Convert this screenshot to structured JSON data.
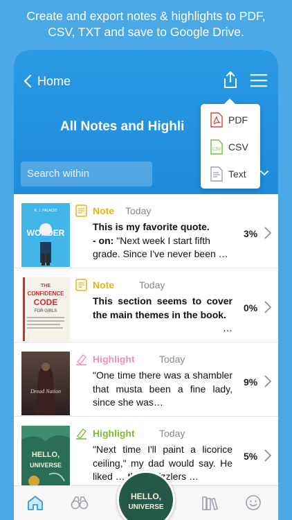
{
  "promo": {
    "line1": "Create and export notes & highlights to PDF,",
    "line2": "CSV, TXT and save to Google Drive."
  },
  "header": {
    "back_label": "Home",
    "title": "All Notes and Highli",
    "search_placeholder": "Search within"
  },
  "export_menu": {
    "items": [
      {
        "label": "PDF",
        "icon": "pdf-file-icon",
        "color": "#d9413a"
      },
      {
        "label": "CSV",
        "icon": "csv-file-icon",
        "color": "#6fbf3f"
      },
      {
        "label": "Text",
        "icon": "text-file-icon",
        "color": "#9aa3ad"
      }
    ]
  },
  "entries": [
    {
      "type": "Note",
      "type_color": "#e8b315",
      "date": "Today",
      "title": "This is my favorite quote.",
      "on_label": "- on:",
      "text": "\"Next week I start fifth grade. Since I've never been …",
      "percent": "3%",
      "cover_title": "WONDER",
      "cover_author": "R. J. PALACIO"
    },
    {
      "type": "Note",
      "type_color": "#e8b315",
      "date": "Today",
      "title": "This section seems to cover the main themes in the book.",
      "text": "…",
      "percent": "0%",
      "cover_title": "THE CONFIDENCE CODE",
      "cover_subtitle": "FOR GIRLS"
    },
    {
      "type": "Highlight",
      "type_color": "#f08fbf",
      "date": "Today",
      "text": "\"One time there was a shambler that musta been a fine lady, since she was…",
      "percent": "9%",
      "cover_title": "Dread Nation"
    },
    {
      "type": "Highlight",
      "type_color": "#7cbf2a",
      "date": "Today",
      "text": "\"Next time I'll paint a licorice ceiling,\" my dad would say. He liked … that Twizzlers …",
      "percent": "5%",
      "cover_title": "HELLO, UNIVERSE"
    }
  ],
  "tabbar": {
    "tabs": [
      "home-icon",
      "binoculars-icon",
      "current-book",
      "library-icon",
      "smiley-icon"
    ],
    "active_color": "#2a9ae4",
    "center_cover_title": "HELLO, UNIVERSE"
  },
  "colors": {
    "background": "#4aa8e6",
    "header": "#2a9ae4"
  }
}
